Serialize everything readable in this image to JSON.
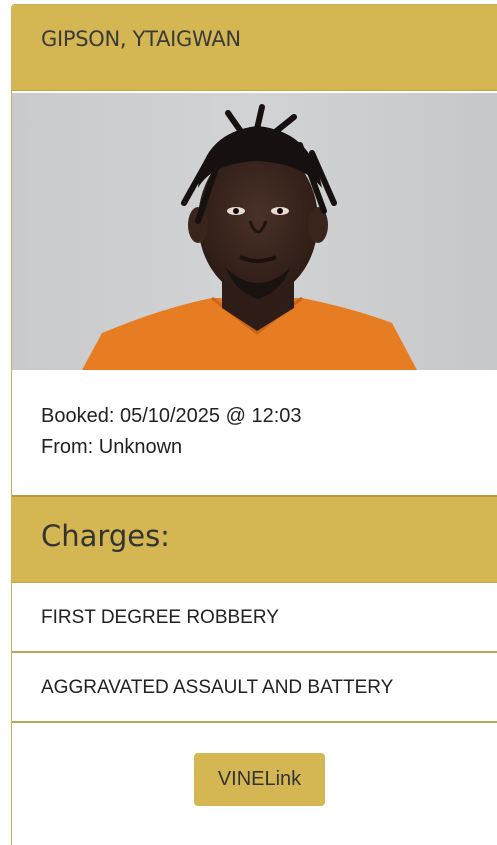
{
  "inmate": {
    "name": "GIPSON, YTAIGWAN",
    "booked": "Booked: 05/10/2025 @ 12:03",
    "from": "From: Unknown"
  },
  "charges": {
    "title": "Charges:",
    "items": [
      "FIRST DEGREE ROBBERY",
      "AGGRAVATED ASSAULT AND BATTERY"
    ]
  },
  "actions": {
    "vinelink_label": "VINELink"
  },
  "colors": {
    "accent": "#d4b653",
    "divider": "#b8a85a",
    "jumpsuit": "#e77d22"
  }
}
